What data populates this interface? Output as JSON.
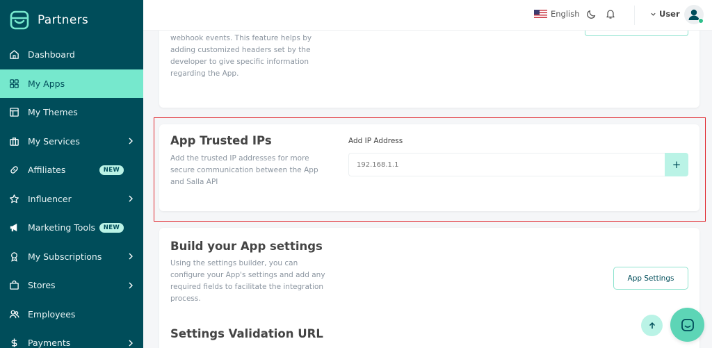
{
  "brand": {
    "name": "Partners"
  },
  "sidebar": {
    "items": [
      {
        "label": "Dashboard",
        "icon": "home-icon"
      },
      {
        "label": "My Apps",
        "icon": "apps-grid-icon",
        "active": true
      },
      {
        "label": "My Themes",
        "icon": "themes-icon"
      },
      {
        "label": "My Services",
        "icon": "briefcase-icon",
        "has_submenu": true
      },
      {
        "label": "Affiliates",
        "icon": "link-icon",
        "badge": "NEW"
      },
      {
        "label": "Influencer",
        "icon": "star-icon",
        "has_submenu": true
      },
      {
        "label": "Marketing Tools",
        "icon": "megaphone-icon",
        "badge": "NEW"
      },
      {
        "label": "My Subscriptions",
        "icon": "medal-icon",
        "has_submenu": true
      },
      {
        "label": "Stores",
        "icon": "store-icon",
        "has_submenu": true
      },
      {
        "label": "Employees",
        "icon": "employees-icon"
      },
      {
        "label": "Payments",
        "icon": "dollar-icon",
        "has_submenu": true
      }
    ]
  },
  "topbar": {
    "language": "English",
    "user_name": "User",
    "icons": [
      "us-flag-icon",
      "moon-icon",
      "bell-icon",
      "chevron-down-icon",
      "avatar-icon"
    ]
  },
  "webhook_card": {
    "description": "webhook events. This feature helps by adding customized headers set by the developer to give specific information regarding the App."
  },
  "trusted_ips": {
    "title": "App Trusted IPs",
    "description": "Add the trusted IP addresses for more secure communication between the App and Salla API",
    "field_label": "Add IP Address",
    "placeholder": "192.168.1.1",
    "add_button": "+"
  },
  "settings_card": {
    "title": "Build your App settings",
    "description": "Using the settings builder, you can configure your App's settings and add any required fields to facilitate the integration process.",
    "button_label": "App Settings",
    "next_title": "Settings Validation URL"
  },
  "colors": {
    "sidebar_bg": "#004d5a",
    "active_item_bg": "#76e8cd",
    "accent": "#5dd5b6",
    "highlight_border": "#e0262d"
  }
}
